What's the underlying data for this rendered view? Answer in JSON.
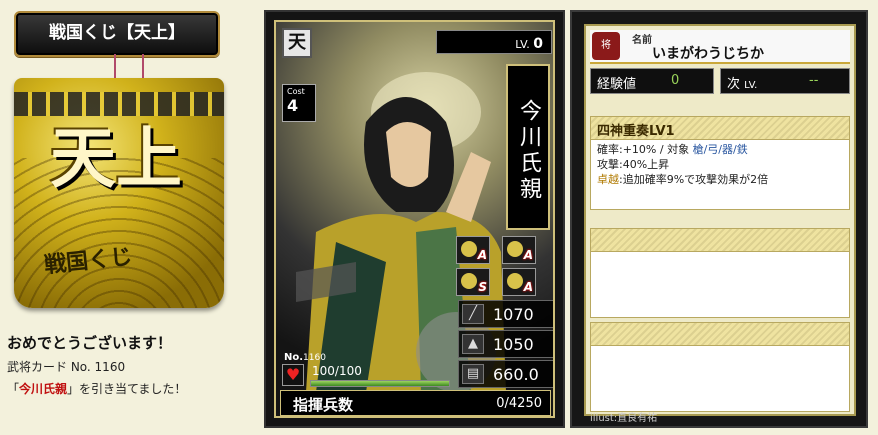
{
  "left": {
    "title": "戦国くじ【天上】",
    "bag_big": "天上",
    "bag_small": "戦国くじ",
    "congrats": "おめでとうございます！",
    "card_number_text": "武将カード No. 1160",
    "result_prefix": "「",
    "result_name": "今川氏親",
    "result_suffix": "」を引き当てました！"
  },
  "card": {
    "rank": "天",
    "level_label": "LV.",
    "level": "0",
    "cost_label": "Cost",
    "cost": "4",
    "name": "今川氏親",
    "skills": [
      {
        "icon": "spear-soldier-icon",
        "grade": "A"
      },
      {
        "icon": "cavalry-horse-icon",
        "grade": "A"
      },
      {
        "icon": "bow-icon",
        "grade": "S"
      },
      {
        "icon": "cannon-icon",
        "grade": "A"
      }
    ],
    "attack": "1070",
    "defense": "1050",
    "strategy": "660.0",
    "no_label": "No.",
    "no": "1160",
    "hp": "100/100",
    "hp_fraction": 1.0,
    "command_label": "指揮兵数",
    "command_value": "0/4250"
  },
  "detail": {
    "general_icon_text": "将",
    "name_label": "名前",
    "name_kana": "いまがわうじちか",
    "exp_label": "経験値",
    "exp_value": "0",
    "next_label": "次",
    "next_sub": "LV.",
    "next_value": "--",
    "skill_title": "四神重奏LV1",
    "skill_line1_a": "確率:+10%  /  対象 ",
    "skill_line1_b": "槍/弓/器/鉄",
    "skill_line2": "攻撃:40%上昇",
    "skill_line3_a": "卓越",
    "skill_line3_b": ":追加確率9%で攻撃効果が2倍",
    "illust": "illust:直良有祐"
  }
}
